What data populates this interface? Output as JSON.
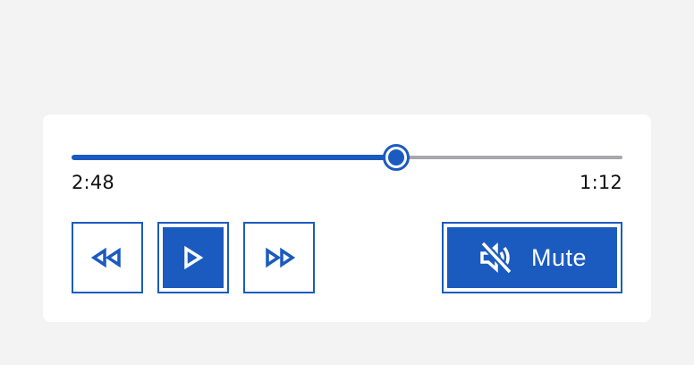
{
  "player": {
    "progress_percent": 58.8,
    "elapsed_time": "2:48",
    "remaining_time": "1:12",
    "colors": {
      "accent": "#1b5bbf",
      "track": "#a7a7ad",
      "background": "#f3f3f3",
      "panel": "#ffffff"
    },
    "controls": {
      "rewind_icon": "rewind-icon",
      "play_icon": "play-icon",
      "forward_icon": "fast-forward-icon",
      "mute_icon": "speaker-muted-icon",
      "mute_label": "Mute"
    }
  }
}
